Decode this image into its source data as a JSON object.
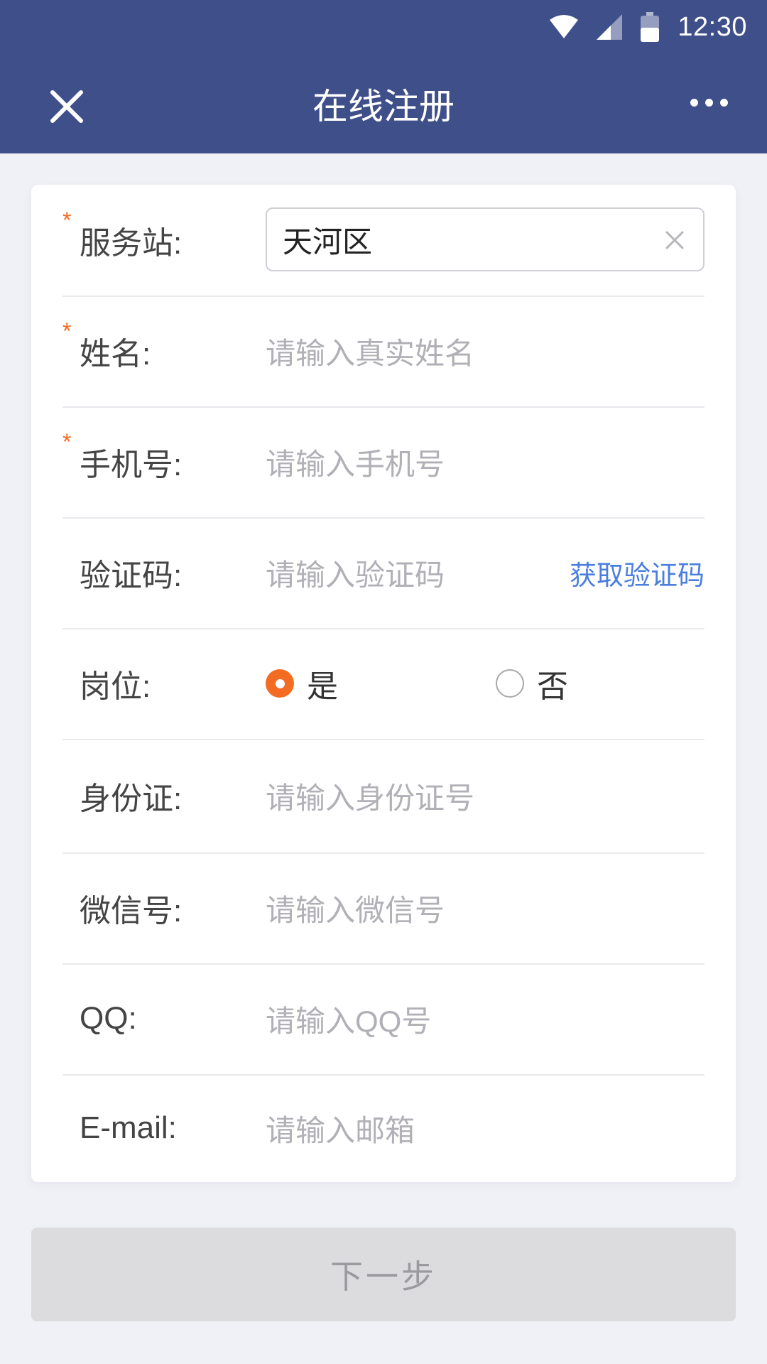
{
  "status_bar": {
    "time": "12:30"
  },
  "header": {
    "title": "在线注册"
  },
  "form": {
    "service_station": {
      "label": "服务站:",
      "value": "天河区",
      "required": true
    },
    "name": {
      "label": "姓名:",
      "placeholder": "请输入真实姓名",
      "required": true
    },
    "phone": {
      "label": "手机号:",
      "placeholder": "请输入手机号",
      "required": true
    },
    "code": {
      "label": "验证码:",
      "placeholder": "请输入验证码",
      "action": "获取验证码"
    },
    "position": {
      "label": "岗位:",
      "options": [
        "是",
        "否"
      ],
      "selected": "是"
    },
    "id_card": {
      "label": "身份证:",
      "placeholder": "请输入身份证号"
    },
    "wechat": {
      "label": "微信号:",
      "placeholder": "请输入微信号"
    },
    "qq": {
      "label": "QQ:",
      "placeholder": "请输入QQ号"
    },
    "email": {
      "label": "E-mail:",
      "placeholder": "请输入邮箱"
    },
    "required_mark": "*"
  },
  "next_button": {
    "label": "下一步"
  },
  "colors": {
    "header_bg": "#3f4f8a",
    "accent": "#f36c21",
    "link": "#4a7fe0",
    "page_bg": "#f0f1f6",
    "button_disabled_bg": "#dcdcde"
  }
}
